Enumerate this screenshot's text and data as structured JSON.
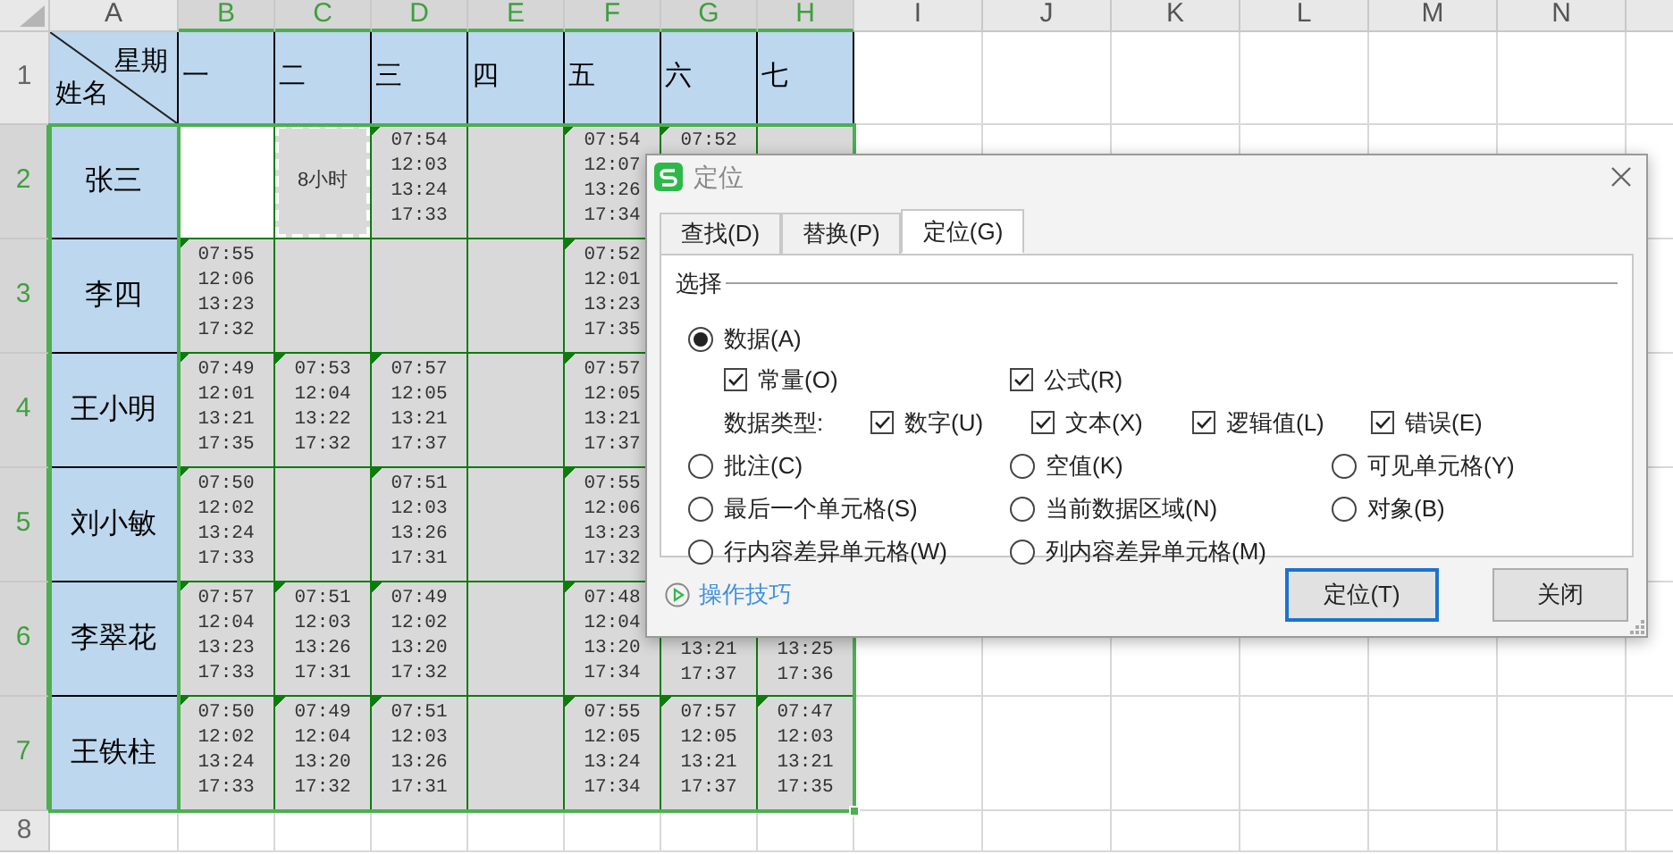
{
  "sheet": {
    "column_headers": [
      {
        "label": "A",
        "selected": false
      },
      {
        "label": "B",
        "selected": true
      },
      {
        "label": "C",
        "selected": true
      },
      {
        "label": "D",
        "selected": true
      },
      {
        "label": "E",
        "selected": true
      },
      {
        "label": "F",
        "selected": true
      },
      {
        "label": "G",
        "selected": true
      },
      {
        "label": "H",
        "selected": true
      },
      {
        "label": "I",
        "selected": false
      },
      {
        "label": "J",
        "selected": false
      },
      {
        "label": "K",
        "selected": false
      },
      {
        "label": "L",
        "selected": false
      },
      {
        "label": "M",
        "selected": false
      },
      {
        "label": "N",
        "selected": false
      }
    ],
    "row_headers": [
      {
        "label": "1",
        "selected": false
      },
      {
        "label": "2",
        "selected": true
      },
      {
        "label": "3",
        "selected": true
      },
      {
        "label": "4",
        "selected": true
      },
      {
        "label": "5",
        "selected": true
      },
      {
        "label": "6",
        "selected": true
      },
      {
        "label": "7",
        "selected": true
      },
      {
        "label": "8",
        "selected": false
      }
    ],
    "corner_header": {
      "top": "星期",
      "bottom": "姓名"
    },
    "day_headers": [
      "一",
      "二",
      "三",
      "四",
      "五",
      "六",
      "七"
    ],
    "rows": [
      {
        "name": "张三",
        "cells": [
          {
            "kind": "active"
          },
          {
            "kind": "marquee",
            "text": "8小时"
          },
          {
            "kind": "times",
            "lines": [
              "07:54",
              "12:03",
              "13:24",
              "17:33"
            ]
          },
          {
            "kind": "blank"
          },
          {
            "kind": "times",
            "lines": [
              "07:54",
              "12:07",
              "13:26",
              "17:34"
            ]
          },
          {
            "kind": "times",
            "lines": [
              "07:52"
            ]
          },
          null
        ]
      },
      {
        "name": "李四",
        "cells": [
          {
            "kind": "times",
            "lines": [
              "07:55",
              "12:06",
              "13:23",
              "17:32"
            ]
          },
          {
            "kind": "blank"
          },
          {
            "kind": "blank"
          },
          {
            "kind": "blank"
          },
          {
            "kind": "times",
            "lines": [
              "07:52",
              "12:01",
              "13:23",
              "17:35"
            ]
          },
          null,
          null
        ]
      },
      {
        "name": "王小明",
        "cells": [
          {
            "kind": "times",
            "lines": [
              "07:49",
              "12:01",
              "13:21",
              "17:35"
            ]
          },
          {
            "kind": "times",
            "lines": [
              "07:53",
              "12:04",
              "13:22",
              "17:32"
            ]
          },
          {
            "kind": "times",
            "lines": [
              "07:57",
              "12:05",
              "13:21",
              "17:37"
            ]
          },
          {
            "kind": "blank"
          },
          {
            "kind": "times",
            "lines": [
              "07:57",
              "12:05",
              "13:21",
              "17:37"
            ]
          },
          null,
          null
        ]
      },
      {
        "name": "刘小敏",
        "cells": [
          {
            "kind": "times",
            "lines": [
              "07:50",
              "12:02",
              "13:24",
              "17:33"
            ]
          },
          {
            "kind": "blank"
          },
          {
            "kind": "times",
            "lines": [
              "07:51",
              "12:03",
              "13:26",
              "17:31"
            ]
          },
          {
            "kind": "blank"
          },
          {
            "kind": "times",
            "lines": [
              "07:55",
              "12:06",
              "13:23",
              "17:32"
            ]
          },
          null,
          null
        ]
      },
      {
        "name": "李翠花",
        "cells": [
          {
            "kind": "times",
            "lines": [
              "07:57",
              "12:04",
              "13:23",
              "17:33"
            ]
          },
          {
            "kind": "times",
            "lines": [
              "07:51",
              "12:03",
              "13:26",
              "17:31"
            ]
          },
          {
            "kind": "times",
            "lines": [
              "07:49",
              "12:02",
              "13:20",
              "17:32"
            ]
          },
          {
            "kind": "blank"
          },
          {
            "kind": "times",
            "lines": [
              "07:48",
              "12:04",
              "13:20",
              "17:34"
            ]
          },
          {
            "kind": "partial",
            "lines": [
              "13:21",
              "17:37"
            ]
          },
          {
            "kind": "partial",
            "lines": [
              "13:25",
              "17:36"
            ]
          }
        ]
      },
      {
        "name": "王铁柱",
        "cells": [
          {
            "kind": "times",
            "lines": [
              "07:50",
              "12:02",
              "13:24",
              "17:33"
            ]
          },
          {
            "kind": "times",
            "lines": [
              "07:49",
              "12:04",
              "13:20",
              "17:32"
            ]
          },
          {
            "kind": "times",
            "lines": [
              "07:51",
              "12:03",
              "13:26",
              "17:31"
            ]
          },
          {
            "kind": "blank"
          },
          {
            "kind": "times",
            "lines": [
              "07:55",
              "12:05",
              "13:24",
              "17:34"
            ]
          },
          {
            "kind": "times",
            "lines": [
              "07:57",
              "12:05",
              "13:21",
              "17:37"
            ]
          },
          {
            "kind": "times",
            "lines": [
              "07:47",
              "12:03",
              "13:21",
              "17:35"
            ]
          }
        ]
      }
    ]
  },
  "dialog": {
    "title": "定位",
    "tabs": [
      {
        "label": "查找(D)",
        "selected": false
      },
      {
        "label": "替换(P)",
        "selected": false
      },
      {
        "label": "定位(G)",
        "selected": true
      }
    ],
    "group_label": "选择",
    "data_option": {
      "label": "数据(A)",
      "selected": true
    },
    "data_checks": [
      {
        "label": "常量(O)",
        "checked": true
      },
      {
        "label": "公式(R)",
        "checked": true
      }
    ],
    "data_type_label": "数据类型:",
    "type_checks": [
      {
        "label": "数字(U)",
        "checked": true
      },
      {
        "label": "文本(X)",
        "checked": true
      },
      {
        "label": "逻辑值(L)",
        "checked": true
      },
      {
        "label": "错误(E)",
        "checked": true
      }
    ],
    "options": [
      {
        "label": "批注(C)",
        "selected": false
      },
      {
        "label": "空值(K)",
        "selected": false
      },
      {
        "label": "可见单元格(Y)",
        "selected": false
      },
      {
        "label": "最后一个单元格(S)",
        "selected": false
      },
      {
        "label": "当前数据区域(N)",
        "selected": false
      },
      {
        "label": "对象(B)",
        "selected": false
      },
      {
        "label": "行内容差异单元格(W)",
        "selected": false
      },
      {
        "label": "列内容差异单元格(M)",
        "selected": false
      }
    ],
    "tips_link": "操作技巧",
    "buttons": [
      {
        "label": "定位(T)",
        "default": true
      },
      {
        "label": "关闭",
        "default": false
      }
    ]
  }
}
